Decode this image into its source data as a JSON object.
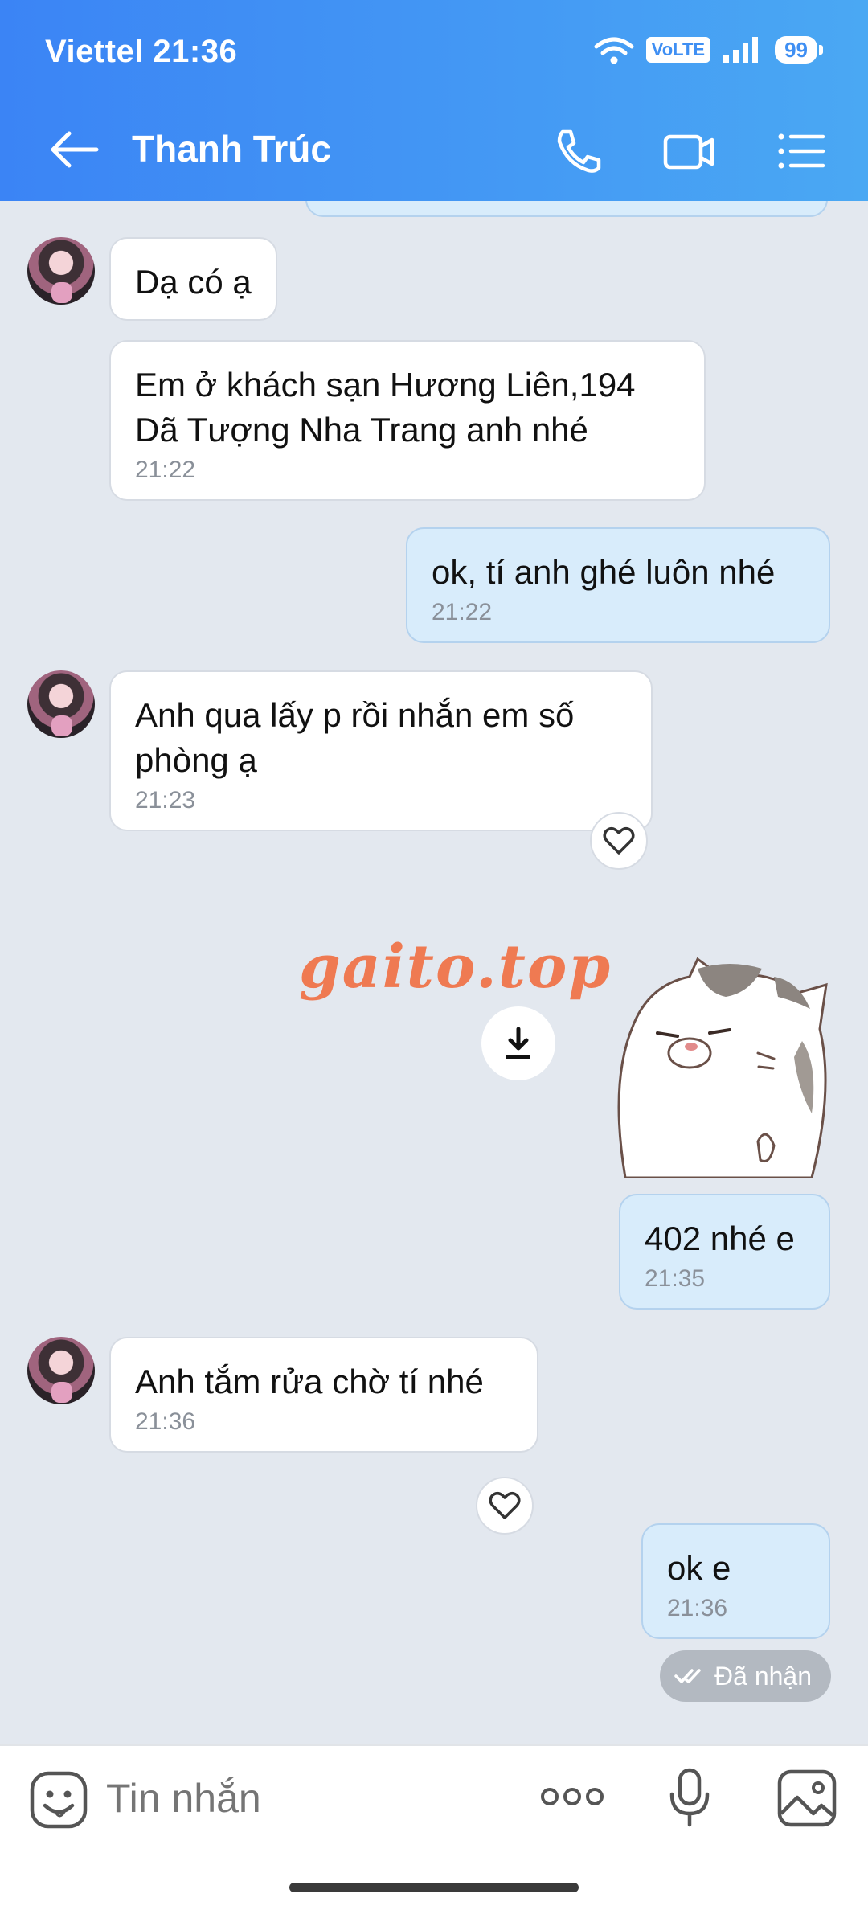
{
  "status_bar": {
    "carrier_time": "Viettel 21:36",
    "volte": "VoLTE",
    "battery": "99"
  },
  "header": {
    "contact_name": "Thanh Trúc"
  },
  "messages": [
    {
      "direction": "in",
      "text": "Dạ có ạ"
    },
    {
      "direction": "in",
      "text": "Em ở khách sạn Hương Liên,194 Dã Tượng Nha Trang anh nhé",
      "time": "21:22"
    },
    {
      "direction": "out",
      "text": "ok, tí anh ghé luôn nhé",
      "time": "21:22"
    },
    {
      "direction": "in",
      "text": "Anh qua lấy p rồi nhắn em số phòng ạ",
      "time": "21:23"
    },
    {
      "direction": "out",
      "text": "402 nhé e",
      "time": "21:35"
    },
    {
      "direction": "in",
      "text": "Anh tắm rửa chờ tí nhé",
      "time": "21:36"
    },
    {
      "direction": "out",
      "text": "ok e",
      "time": "21:36"
    }
  ],
  "watermark": "gaito.top",
  "seen_label": "Đã nhận",
  "composer": {
    "placeholder": "Tin nhắn"
  }
}
